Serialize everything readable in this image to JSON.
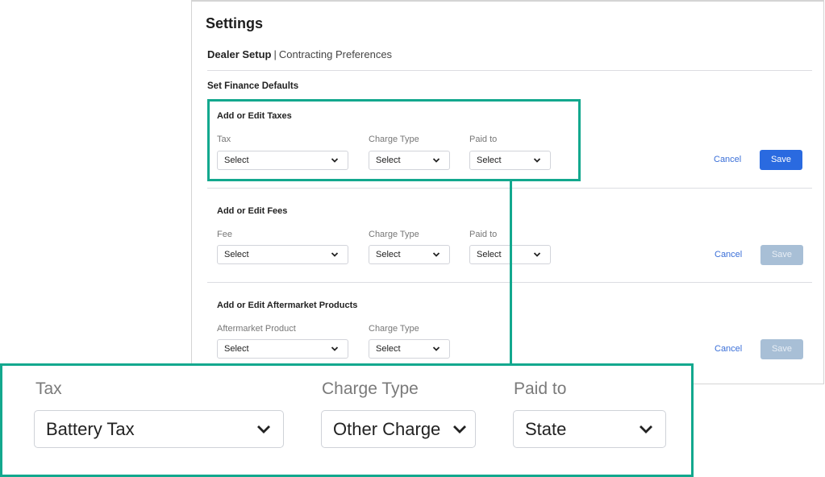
{
  "page": {
    "title": "Settings",
    "subnav": {
      "active": "Dealer Setup",
      "separator": "|",
      "link": "Contracting Preferences"
    },
    "section_title": "Set Finance Defaults"
  },
  "taxes": {
    "heading": "Add or Edit Taxes",
    "fields": [
      {
        "label": "Tax",
        "value": "Select"
      },
      {
        "label": "Charge Type",
        "value": "Select"
      },
      {
        "label": "Paid to",
        "value": "Select"
      }
    ],
    "cancel": "Cancel",
    "save": "Save",
    "save_enabled": true
  },
  "fees": {
    "heading": "Add or Edit Fees",
    "fields": [
      {
        "label": "Fee",
        "value": "Select"
      },
      {
        "label": "Charge Type",
        "value": "Select"
      },
      {
        "label": "Paid to",
        "value": "Select"
      }
    ],
    "cancel": "Cancel",
    "save": "Save",
    "save_enabled": false
  },
  "aftermarket": {
    "heading": "Add or Edit Aftermarket Products",
    "fields": [
      {
        "label": "Aftermarket Product",
        "value": "Select"
      },
      {
        "label": "Charge Type",
        "value": "Select"
      }
    ],
    "cancel": "Cancel",
    "save": "Save",
    "save_enabled": false
  },
  "zoom_callout": {
    "fields": [
      {
        "label": "Tax",
        "value": "Battery Tax"
      },
      {
        "label": "Charge Type",
        "value": "Other Charge"
      },
      {
        "label": "Paid to",
        "value": "State"
      }
    ]
  },
  "colors": {
    "highlight": "#13a88e",
    "primary_button": "#2a6ae0",
    "disabled_button": "#a8bfd6",
    "link": "#3a6fd8"
  },
  "icons": {
    "dropdown": "chevron-down-icon"
  }
}
